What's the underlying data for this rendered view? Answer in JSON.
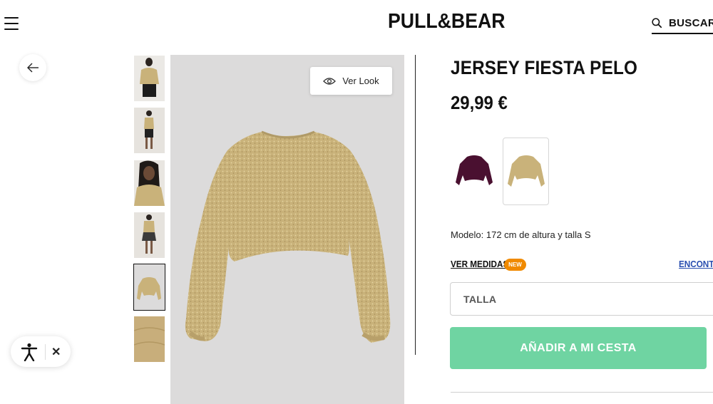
{
  "header": {
    "menu_icon": "hamburger-menu-icon",
    "logo": "PULL&BEAR",
    "search_label": "BUSCAR",
    "search_icon": "search-icon"
  },
  "nav": {
    "back_icon": "arrow-left-icon"
  },
  "gallery": {
    "thumbnails": [
      {
        "kind": "model-front-sweater"
      },
      {
        "kind": "model-full-body"
      },
      {
        "kind": "model-closeup"
      },
      {
        "kind": "model-full-body-skirt"
      },
      {
        "kind": "sweater-flat",
        "active": true
      },
      {
        "kind": "fabric-detail"
      }
    ],
    "ver_look_label": "Ver Look",
    "ver_look_icon": "eye-icon"
  },
  "product": {
    "title": "JERSEY FIESTA PELO",
    "price": "29,99 €",
    "colors": [
      {
        "name": "purple",
        "hex": "#4a1030",
        "selected": false
      },
      {
        "name": "gold",
        "hex": "#c9b27a",
        "selected": true
      }
    ],
    "model_info": "Modelo: 172 cm de altura y talla S",
    "ver_medidas": "VER MEDIDAS",
    "new_badge": "NEW",
    "encontrar": "ENCONTR",
    "talla_placeholder": "TALLA",
    "add_to_cart": "AÑADIR A MI CESTA"
  },
  "accessibility": {
    "icon": "accessibility-person-icon",
    "close_icon": "close-icon",
    "close_glyph": "✕"
  },
  "colors": {
    "accent_green": "#6fd4a2",
    "badge_orange": "#f08a00",
    "link_blue": "#2a4fb0",
    "image_bg": "#dcdbdb",
    "sweater": "#c9b27a"
  }
}
